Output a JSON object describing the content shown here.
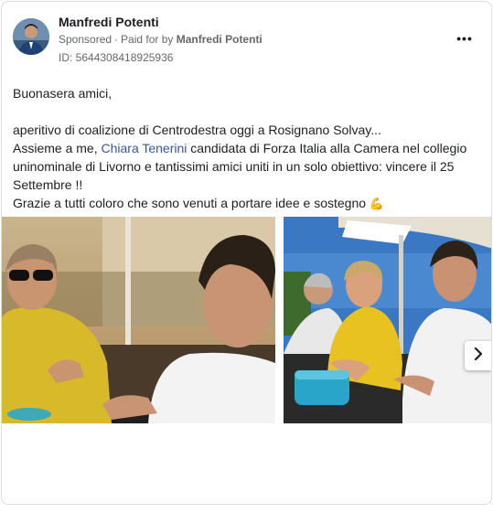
{
  "post": {
    "author": "Manfredi Potenti",
    "sponsored_label": "Sponsored",
    "paid_for_label": "Paid for by",
    "paid_for_name": "Manfredi Potenti",
    "ad_id": "ID: 5644308418925936",
    "more_label": "•••",
    "text": {
      "line1": "Buonasera amici,",
      "line2": "aperitivo di coalizione di Centrodestra oggi a Rosignano Solvay...",
      "line3_before": "Assieme a me, ",
      "line3_link": "Chiara Tenerini",
      "line3_after": " candidata di Forza Italia alla Camera nel collegio uninominale di Livorno e tantissimi amici uniti in un solo obiettivo: vincere il 25 Settembre !!",
      "line4": "Grazie a tutti coloro che sono venuti a portare idee e sostegno",
      "emoji": "💪"
    },
    "carousel": {
      "next_icon": "chevron-right-icon"
    }
  }
}
